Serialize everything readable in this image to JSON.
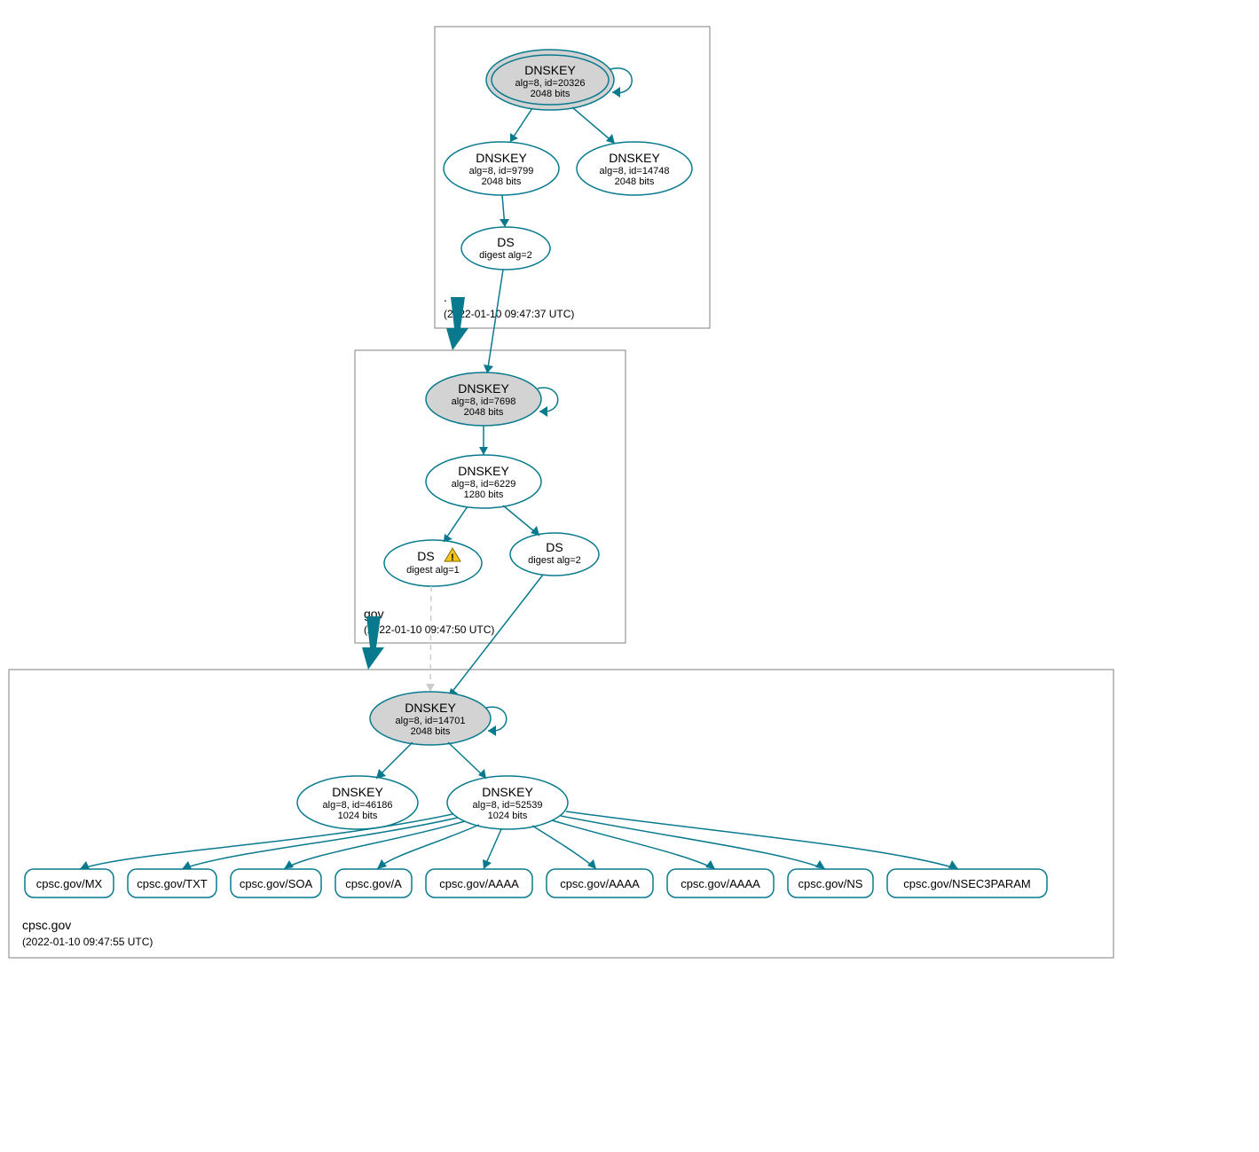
{
  "zones": {
    "root": {
      "label": ".",
      "timestamp": "(2022-01-10 09:47:37 UTC)"
    },
    "gov": {
      "label": "gov",
      "timestamp": "(2022-01-10 09:47:50 UTC)"
    },
    "cpsc": {
      "label": "cpsc.gov",
      "timestamp": "(2022-01-10 09:47:55 UTC)"
    }
  },
  "nodes": {
    "root_ksk": {
      "title": "DNSKEY",
      "sub1": "alg=8, id=20326",
      "sub2": "2048 bits"
    },
    "root_zsk1": {
      "title": "DNSKEY",
      "sub1": "alg=8, id=9799",
      "sub2": "2048 bits"
    },
    "root_zsk2": {
      "title": "DNSKEY",
      "sub1": "alg=8, id=14748",
      "sub2": "2048 bits"
    },
    "root_ds": {
      "title": "DS",
      "sub1": "digest alg=2"
    },
    "gov_ksk": {
      "title": "DNSKEY",
      "sub1": "alg=8, id=7698",
      "sub2": "2048 bits"
    },
    "gov_zsk": {
      "title": "DNSKEY",
      "sub1": "alg=8, id=6229",
      "sub2": "1280 bits"
    },
    "gov_ds1": {
      "title": "DS",
      "sub1": "digest alg=1"
    },
    "gov_ds2": {
      "title": "DS",
      "sub1": "digest alg=2"
    },
    "cpsc_ksk": {
      "title": "DNSKEY",
      "sub1": "alg=8, id=14701",
      "sub2": "2048 bits"
    },
    "cpsc_zsk1": {
      "title": "DNSKEY",
      "sub1": "alg=8, id=46186",
      "sub2": "1024 bits"
    },
    "cpsc_zsk2": {
      "title": "DNSKEY",
      "sub1": "alg=8, id=52539",
      "sub2": "1024 bits"
    }
  },
  "rr": {
    "mx": "cpsc.gov/MX",
    "txt": "cpsc.gov/TXT",
    "soa": "cpsc.gov/SOA",
    "a": "cpsc.gov/A",
    "aaaa1": "cpsc.gov/AAAA",
    "aaaa2": "cpsc.gov/AAAA",
    "aaaa3": "cpsc.gov/AAAA",
    "ns": "cpsc.gov/NS",
    "nsec3": "cpsc.gov/NSEC3PARAM"
  }
}
